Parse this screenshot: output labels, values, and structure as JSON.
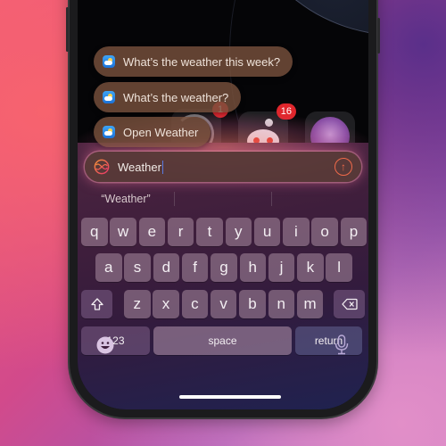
{
  "suggestions": [
    {
      "label": "What’s the weather this week?",
      "icon": "weather-app-icon"
    },
    {
      "label": "What’s the weather?",
      "icon": "weather-app-icon"
    },
    {
      "label": "Open Weather",
      "icon": "weather-app-icon"
    }
  ],
  "home_screen": {
    "badges": {
      "reddit": "16",
      "partial": "1"
    }
  },
  "search": {
    "value": "Weather",
    "assistant_icon": "siri-icon",
    "send_icon": "arrow-up-circle-icon"
  },
  "predictive": [
    "“Weather”",
    "",
    ""
  ],
  "keyboard": {
    "row1": [
      "q",
      "w",
      "e",
      "r",
      "t",
      "y",
      "u",
      "i",
      "o",
      "p"
    ],
    "row2": [
      "a",
      "s",
      "d",
      "f",
      "g",
      "h",
      "j",
      "k",
      "l"
    ],
    "row3": [
      "z",
      "x",
      "c",
      "v",
      "b",
      "n",
      "m"
    ],
    "shift_icon": "shift-icon",
    "delete_icon": "delete-icon",
    "numbers_label": "123",
    "space_label": "space",
    "return_label": "return",
    "emoji_icon": "emoji-icon",
    "mic_icon": "microphone-icon"
  },
  "colors": {
    "accent": "#f06a4a",
    "suggestion_bg": "#78503c",
    "badge": "#e0262c"
  }
}
